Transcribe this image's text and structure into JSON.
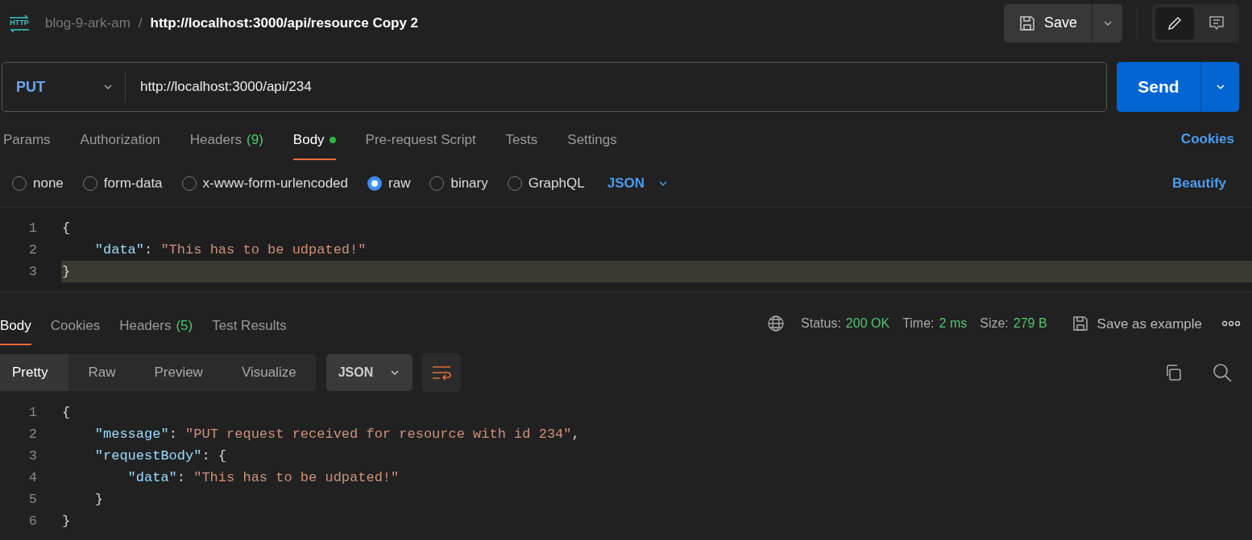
{
  "header": {
    "app_icon_label": "HTTP",
    "collection": "blog-9-ark-am",
    "separator": "/",
    "title": "http://localhost:3000/api/resource Copy 2",
    "save_label": "Save"
  },
  "request": {
    "method": "PUT",
    "url": "http://localhost:3000/api/234",
    "send_label": "Send"
  },
  "request_tabs": [
    {
      "label": "Params",
      "selected": false
    },
    {
      "label": "Authorization",
      "selected": false
    },
    {
      "label": "Headers",
      "count": "(9)",
      "selected": false
    },
    {
      "label": "Body",
      "selected": true,
      "dot": true
    },
    {
      "label": "Pre-request Script",
      "selected": false
    },
    {
      "label": "Tests",
      "selected": false
    },
    {
      "label": "Settings",
      "selected": false
    }
  ],
  "cookies_link": "Cookies",
  "body_types": [
    {
      "label": "none",
      "selected": false
    },
    {
      "label": "form-data",
      "selected": false
    },
    {
      "label": "x-www-form-urlencoded",
      "selected": false
    },
    {
      "label": "raw",
      "selected": true
    },
    {
      "label": "binary",
      "selected": false
    },
    {
      "label": "GraphQL",
      "selected": false
    }
  ],
  "body_format": "JSON",
  "beautify_label": "Beautify",
  "request_editor": [
    {
      "number": "1",
      "current": false,
      "tokens": [
        {
          "kind": "punct",
          "text": "{"
        }
      ]
    },
    {
      "number": "2",
      "current": false,
      "tokens": [
        {
          "kind": "indent"
        },
        {
          "kind": "key",
          "text": "\"data\""
        },
        {
          "kind": "punct",
          "text": ": "
        },
        {
          "kind": "string",
          "text": "\"This has to be udpated!\""
        }
      ]
    },
    {
      "number": "3",
      "current": true,
      "tokens": [
        {
          "kind": "punct",
          "text": "}"
        }
      ]
    }
  ],
  "response_tabs": [
    {
      "label": "Body",
      "selected": true
    },
    {
      "label": "Cookies",
      "selected": false
    },
    {
      "label": "Headers",
      "count": "(5)",
      "selected": false
    },
    {
      "label": "Test Results",
      "selected": false
    }
  ],
  "response_meta": [
    {
      "label": "Status:",
      "value": "200 OK"
    },
    {
      "label": "Time:",
      "value": "2 ms"
    },
    {
      "label": "Size:",
      "value": "279 B"
    }
  ],
  "save_example_label": "Save as example",
  "view_modes": [
    {
      "label": "Pretty",
      "selected": true
    },
    {
      "label": "Raw",
      "selected": false
    },
    {
      "label": "Preview",
      "selected": false
    },
    {
      "label": "Visualize",
      "selected": false
    }
  ],
  "response_format": "JSON",
  "response_editor": [
    {
      "number": "1",
      "tokens": [
        {
          "kind": "punct",
          "text": "{"
        }
      ]
    },
    {
      "number": "2",
      "tokens": [
        {
          "kind": "indent"
        },
        {
          "kind": "key",
          "text": "\"message\""
        },
        {
          "kind": "punct",
          "text": ": "
        },
        {
          "kind": "string",
          "text": "\"PUT request received for resource with id 234\""
        },
        {
          "kind": "punct",
          "text": ","
        }
      ]
    },
    {
      "number": "3",
      "tokens": [
        {
          "kind": "indent"
        },
        {
          "kind": "key",
          "text": "\"requestBody\""
        },
        {
          "kind": "punct",
          "text": ": {"
        }
      ]
    },
    {
      "number": "4",
      "tokens": [
        {
          "kind": "indent"
        },
        {
          "kind": "indent"
        },
        {
          "kind": "key",
          "text": "\"data\""
        },
        {
          "kind": "punct",
          "text": ": "
        },
        {
          "kind": "string",
          "text": "\"This has to be udpated!\""
        }
      ]
    },
    {
      "number": "5",
      "tokens": [
        {
          "kind": "indent"
        },
        {
          "kind": "punct",
          "text": "}"
        }
      ]
    },
    {
      "number": "6",
      "tokens": [
        {
          "kind": "punct",
          "text": "}"
        }
      ]
    }
  ]
}
